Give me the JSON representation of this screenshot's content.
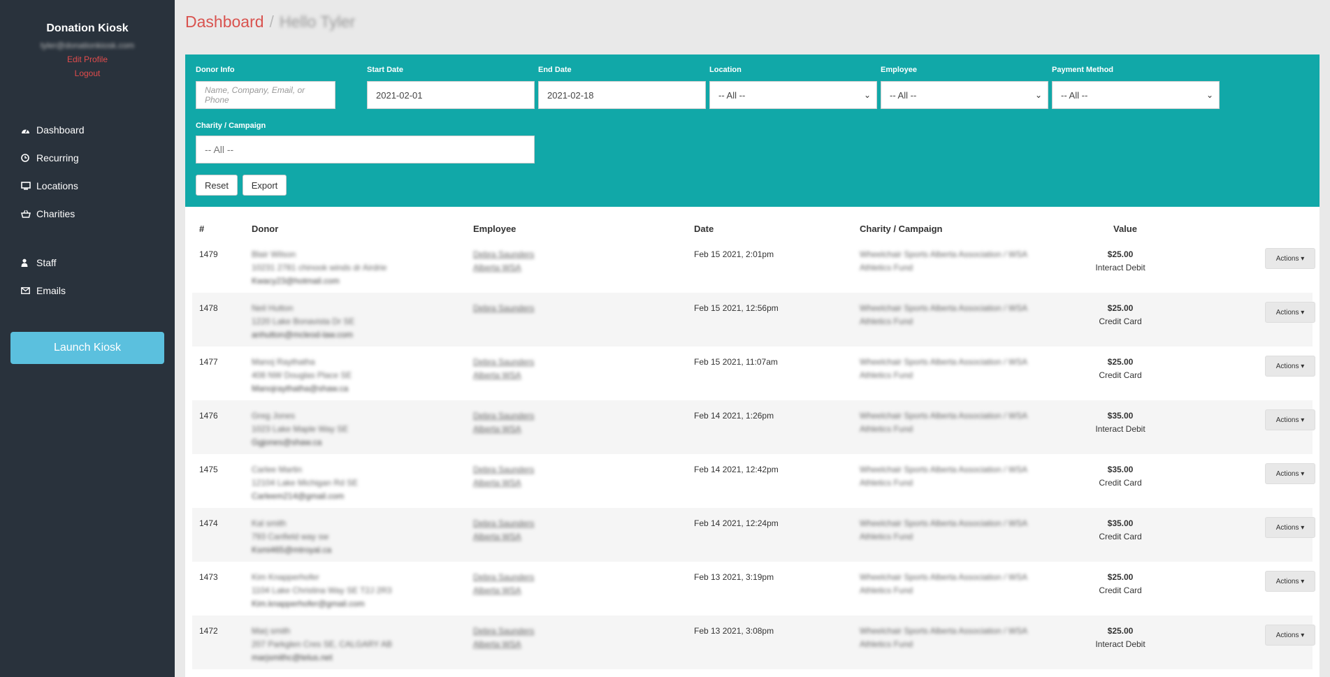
{
  "sidebar": {
    "brand": "Donation Kiosk",
    "email": "tyler@donationkiosk.com",
    "edit_profile": "Edit Profile",
    "logout": "Logout",
    "nav": [
      {
        "label": "Dashboard",
        "icon": "dashboard-icon"
      },
      {
        "label": "Recurring",
        "icon": "clock-icon"
      },
      {
        "label": "Locations",
        "icon": "monitor-icon"
      },
      {
        "label": "Charities",
        "icon": "basket-icon"
      },
      {
        "label": "Staff",
        "icon": "user-icon"
      },
      {
        "label": "Emails",
        "icon": "envelope-icon"
      }
    ],
    "launch": "Launch Kiosk"
  },
  "header": {
    "title": "Dashboard",
    "separator": "/",
    "greeting": "Hello Tyler"
  },
  "filters": {
    "donor_label": "Donor Info",
    "donor_placeholder": "Name, Company, Email, or Phone",
    "start_label": "Start Date",
    "start_value": "2021-02-01",
    "end_label": "End Date",
    "end_value": "2021-02-18",
    "location_label": "Location",
    "location_value": "-- All --",
    "employee_label": "Employee",
    "employee_value": "-- All --",
    "payment_label": "Payment Method",
    "payment_value": "-- All --",
    "charity_label": "Charity / Campaign",
    "charity_value": "-- All --",
    "reset": "Reset",
    "export": "Export"
  },
  "table": {
    "headers": [
      "#",
      "Donor",
      "Employee",
      "Date",
      "Charity / Campaign",
      "Value"
    ],
    "actions_label": "Actions ▾",
    "rows": [
      {
        "id": "1479",
        "donor": [
          "Blair Wilson",
          "10231 2781 chinook winds dr Airdrie",
          "Kwacy23@hotmail.com"
        ],
        "employee": [
          "Debra Saunders",
          "Alberta WSA"
        ],
        "date": "Feb 15 2021, 2:01pm",
        "charity": [
          "Wheelchair Sports Alberta Association / WSA",
          "Athletics Fund"
        ],
        "amount": "$25.00",
        "method": "Interact Debit"
      },
      {
        "id": "1478",
        "donor": [
          "Neil Hutton",
          "1220 Lake Bonavista Dr SE",
          "anhutton@mcleod-law.com"
        ],
        "employee": [
          "Debra Saunders",
          ""
        ],
        "date": "Feb 15 2021, 12:56pm",
        "charity": [
          "Wheelchair Sports Alberta Association / WSA",
          "Athletics Fund"
        ],
        "amount": "$25.00",
        "method": "Credit Card"
      },
      {
        "id": "1477",
        "donor": [
          "Manoj Raythatha",
          "408 NW Douglas Place SE",
          "Manojraythatha@shaw.ca"
        ],
        "employee": [
          "Debra Saunders",
          "Alberta WSA"
        ],
        "date": "Feb 15 2021, 11:07am",
        "charity": [
          "Wheelchair Sports Alberta Association / WSA",
          "Athletics Fund"
        ],
        "amount": "$25.00",
        "method": "Credit Card"
      },
      {
        "id": "1476",
        "donor": [
          "Greg Jones",
          "1023 Lake Maple Way SE",
          "Ggjones@shaw.ca"
        ],
        "employee": [
          "Debra Saunders",
          "Alberta WSA"
        ],
        "date": "Feb 14 2021, 1:26pm",
        "charity": [
          "Wheelchair Sports Alberta Association / WSA",
          "Athletics Fund"
        ],
        "amount": "$35.00",
        "method": "Interact Debit"
      },
      {
        "id": "1475",
        "donor": [
          "Carlee Martin",
          "12104 Lake Michigan Rd SE",
          "Carleem214@gmail.com"
        ],
        "employee": [
          "Debra Saunders",
          "Alberta WSA"
        ],
        "date": "Feb 14 2021, 12:42pm",
        "charity": [
          "Wheelchair Sports Alberta Association / WSA",
          "Athletics Fund"
        ],
        "amount": "$35.00",
        "method": "Credit Card"
      },
      {
        "id": "1474",
        "donor": [
          "Kal smith",
          "793 Canfield way sw",
          "Ksmi465@mtroyal.ca"
        ],
        "employee": [
          "Debra Saunders",
          "Alberta WSA"
        ],
        "date": "Feb 14 2021, 12:24pm",
        "charity": [
          "Wheelchair Sports Alberta Association / WSA",
          "Athletics Fund"
        ],
        "amount": "$35.00",
        "method": "Credit Card"
      },
      {
        "id": "1473",
        "donor": [
          "Kim Knapperhofer",
          "1104 Lake Christina Way SE T2J 2R3",
          "Kim.knapperhofer@gmail.com"
        ],
        "employee": [
          "Debra Saunders",
          "Alberta WSA"
        ],
        "date": "Feb 13 2021, 3:19pm",
        "charity": [
          "Wheelchair Sports Alberta Association / WSA",
          "Athletics Fund"
        ],
        "amount": "$25.00",
        "method": "Credit Card"
      },
      {
        "id": "1472",
        "donor": [
          "Marj smith",
          "207 Parkglen Cres SE, CALGARY AB",
          "marjsmithc@telus.net"
        ],
        "employee": [
          "Debra Saunders",
          "Alberta WSA"
        ],
        "date": "Feb 13 2021, 3:08pm",
        "charity": [
          "Wheelchair Sports Alberta Association / WSA",
          "Athletics Fund"
        ],
        "amount": "$25.00",
        "method": "Interact Debit"
      }
    ]
  }
}
